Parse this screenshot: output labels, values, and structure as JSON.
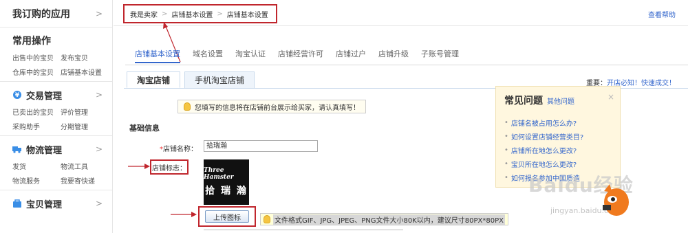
{
  "sidebar": {
    "top_title": "我订购的应用",
    "common_title": "常用操作",
    "common_items": [
      "出售中的宝贝",
      "发布宝贝",
      "仓库中的宝贝",
      "店铺基本设置"
    ],
    "trade_title": "交易管理",
    "trade_items": [
      "已卖出的宝贝",
      "评价管理",
      "采购助手",
      "分期管理"
    ],
    "logistics_title": "物流管理",
    "logistics_items": [
      "发货",
      "物流工具",
      "物流服务",
      "我要寄快递"
    ],
    "goods_title": "宝贝管理"
  },
  "breadcrumb": [
    "我是卖家",
    "店铺基本设置",
    "店铺基本设置"
  ],
  "help_link": "查看帮助",
  "main_tabs": [
    "店铺基本设置",
    "域名设置",
    "淘宝认证",
    "店铺经营许可",
    "店铺过户",
    "店铺升级",
    "子账号管理"
  ],
  "sub_tabs": [
    "淘宝店铺",
    "手机淘宝店铺"
  ],
  "notice": {
    "prefix": "重要：",
    "link": "开店必知！快速成交！"
  },
  "form": {
    "tip": "您填写的信息将在店铺前台展示给买家，请认真填写！",
    "section": "基础信息",
    "name_label": "店铺名称：",
    "name_value": "拾瑞瀚",
    "logo_label": "店铺标志：",
    "logo_line1": "Three Hamster",
    "logo_line2": "拾 瑞 瀚",
    "upload_label": "上传图标",
    "format_tip": "文件格式GIF、JPG、JPEG、PNG文件大小80K以内，建议尺寸80PX*80PX"
  },
  "faq": {
    "title": "常见问题",
    "other": "其他问题",
    "close": "×",
    "items": [
      "店铺名被占用怎么办?",
      "如何设置店铺经营类目?",
      "店铺所在地怎么更改?",
      "宝贝所在地怎么更改?",
      "如何报名参加中国质造"
    ]
  },
  "watermark": {
    "brand": "Baidu经验",
    "url": "jingyan.baidu.com"
  },
  "colors": {
    "accent_red": "#c0262d",
    "link_blue": "#3366cc",
    "faq_bg": "#fff7df"
  }
}
